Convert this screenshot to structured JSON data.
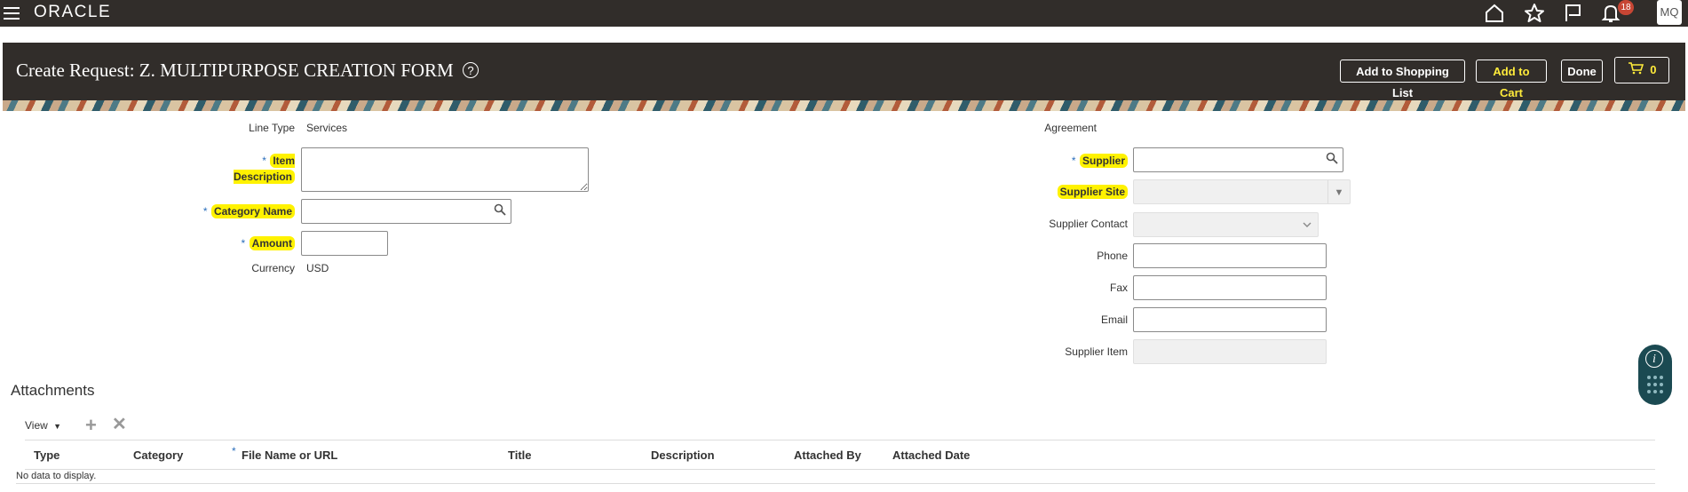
{
  "topbar": {
    "logo": "ORACLE",
    "notification_count": "18",
    "user_initials": "MQ"
  },
  "header": {
    "title": "Create Request: Z. MULTIPURPOSE CREATION FORM",
    "buttons": {
      "add_to_shopping_list": "Add to Shopping List",
      "add_to_cart": "Add to Cart",
      "done": "Done",
      "cart_count": "0"
    }
  },
  "form_left": {
    "line_type_label": "Line Type",
    "line_type_value": "Services",
    "item_description_label": "Item Description",
    "category_name_label": "Category Name",
    "amount_label": "Amount",
    "currency_label": "Currency",
    "currency_value": "USD"
  },
  "form_right": {
    "agreement_label": "Agreement",
    "supplier_label": "Supplier",
    "supplier_site_label": "Supplier Site",
    "supplier_contact_label": "Supplier Contact",
    "phone_label": "Phone",
    "fax_label": "Fax",
    "email_label": "Email",
    "supplier_item_label": "Supplier Item"
  },
  "attachments": {
    "title": "Attachments",
    "view_menu": "View",
    "columns": [
      "Type",
      "Category",
      "File Name or URL",
      "Title",
      "Description",
      "Attached By",
      "Attached Date"
    ],
    "empty_message": "No data to display."
  },
  "colors": {
    "header_bg": "#312d2a",
    "highlight": "#fff200",
    "required": "#2a6ebb",
    "cart_text": "#ffeb3b"
  }
}
